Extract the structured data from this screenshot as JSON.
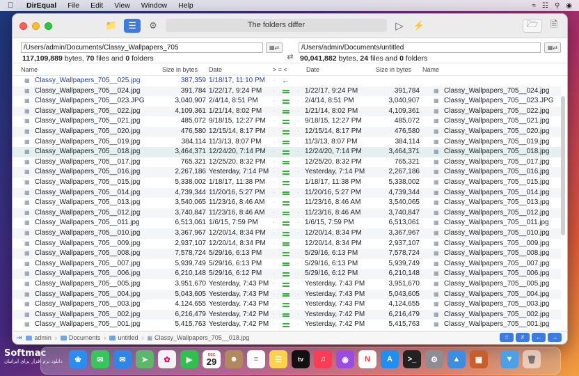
{
  "menubar": {
    "app_name": "DirEqual",
    "items": [
      "File",
      "Edit",
      "View",
      "Window",
      "Help"
    ]
  },
  "toolbar": {
    "status": "The folders differ"
  },
  "left": {
    "path": "/Users/admin/Documents/Classy_Wallpapers_705",
    "bytes": "117,109,889",
    "files": "70",
    "folders": "0"
  },
  "right": {
    "path": "/Users/admin/Documents/untitled",
    "bytes": "90,041,882",
    "files": "24",
    "folders": "0"
  },
  "summary_words": {
    "bytes": "bytes,",
    "files": "files and",
    "folders": "folders"
  },
  "columns": {
    "name": "Name",
    "size": "Size in bytes",
    "date": "Date",
    "compare": "> = <",
    "rdate": "Date",
    "rsize": "Size in bytes",
    "rname": "Name"
  },
  "rows": [
    {
      "lname": "Classy_Wallpapers_705__025.jpg",
      "lsize": "387,359",
      "ldate": "1/18/17, 11:10 PM",
      "cmp": "left",
      "rname": "",
      "rsize": "",
      "rdate": ""
    },
    {
      "lname": "Classy_Wallpapers_705__024.jpg",
      "lsize": "391,784",
      "ldate": "1/22/17, 9:24 PM",
      "cmp": "eq",
      "rname": "Classy_Wallpapers_705__024.jpg",
      "rsize": "391,784",
      "rdate": "1/22/17, 9:24 PM"
    },
    {
      "lname": "Classy_Wallpapers_705__023.JPG",
      "lsize": "3,040,907",
      "ldate": "2/4/14, 8:51 PM",
      "cmp": "eq",
      "rname": "Classy_Wallpapers_705__023.JPG",
      "rsize": "3,040,907",
      "rdate": "2/4/14, 8:51 PM"
    },
    {
      "lname": "Classy_Wallpapers_705__022.jpg",
      "lsize": "4,109,361",
      "ldate": "1/21/14, 8:02 PM",
      "cmp": "eq",
      "rname": "Classy_Wallpapers_705__022.jpg",
      "rsize": "4,109,361",
      "rdate": "1/21/14, 8:02 PM"
    },
    {
      "lname": "Classy_Wallpapers_705__021.jpg",
      "lsize": "485,072",
      "ldate": "9/18/15, 12:27 PM",
      "cmp": "eq",
      "rname": "Classy_Wallpapers_705__021.jpg",
      "rsize": "485,072",
      "rdate": "9/18/15, 12:27 PM"
    },
    {
      "lname": "Classy_Wallpapers_705__020.jpg",
      "lsize": "476,580",
      "ldate": "12/15/14, 8:17 PM",
      "cmp": "eq",
      "rname": "Classy_Wallpapers_705__020.jpg",
      "rsize": "476,580",
      "rdate": "12/15/14, 8:17 PM"
    },
    {
      "lname": "Classy_Wallpapers_705__019.jpg",
      "lsize": "384,114",
      "ldate": "11/3/13, 8:07 PM",
      "cmp": "eq",
      "rname": "Classy_Wallpapers_705__019.jpg",
      "rsize": "384,114",
      "rdate": "11/3/13, 8:07 PM"
    },
    {
      "lname": "Classy_Wallpapers_705__018.jpg",
      "lsize": "3,464,371",
      "ldate": "12/24/20, 7:14 PM",
      "cmp": "eq",
      "rname": "Classy_Wallpapers_705__018.jpg",
      "rsize": "3,464,371",
      "rdate": "12/24/20, 7:14 PM",
      "selected": true
    },
    {
      "lname": "Classy_Wallpapers_705__017.jpg",
      "lsize": "765,321",
      "ldate": "12/25/20, 8:32 PM",
      "cmp": "eq",
      "rname": "Classy_Wallpapers_705__017.jpg",
      "rsize": "765,321",
      "rdate": "12/25/20, 8:32 PM"
    },
    {
      "lname": "Classy_Wallpapers_705__016.jpg",
      "lsize": "2,267,186",
      "ldate": "Yesterday, 7:14 PM",
      "cmp": "eq",
      "rname": "Classy_Wallpapers_705__016.jpg",
      "rsize": "2,267,186",
      "rdate": "Yesterday, 7:14 PM"
    },
    {
      "lname": "Classy_Wallpapers_705__015.jpg",
      "lsize": "5,338,002",
      "ldate": "1/18/17, 11:38 PM",
      "cmp": "eq",
      "rname": "Classy_Wallpapers_705__015.jpg",
      "rsize": "5,338,002",
      "rdate": "1/18/17, 11:38 PM"
    },
    {
      "lname": "Classy_Wallpapers_705__014.jpg",
      "lsize": "4,739,344",
      "ldate": "11/20/16, 5:27 PM",
      "cmp": "eq",
      "rname": "Classy_Wallpapers_705__014.jpg",
      "rsize": "4,739,344",
      "rdate": "11/20/16, 5:27 PM"
    },
    {
      "lname": "Classy_Wallpapers_705__013.jpg",
      "lsize": "3,540,065",
      "ldate": "11/23/16, 8:46 AM",
      "cmp": "eq",
      "rname": "Classy_Wallpapers_705__013.jpg",
      "rsize": "3,540,065",
      "rdate": "11/23/16, 8:46 AM"
    },
    {
      "lname": "Classy_Wallpapers_705__012.jpg",
      "lsize": "3,740,847",
      "ldate": "11/23/16, 8:46 AM",
      "cmp": "eq",
      "rname": "Classy_Wallpapers_705__012.jpg",
      "rsize": "3,740,847",
      "rdate": "11/23/16, 8:46 AM"
    },
    {
      "lname": "Classy_Wallpapers_705__011.jpg",
      "lsize": "6,513,061",
      "ldate": "1/6/15, 7:59 PM",
      "cmp": "eq",
      "rname": "Classy_Wallpapers_705__011.jpg",
      "rsize": "6,513,061",
      "rdate": "1/6/15, 7:59 PM"
    },
    {
      "lname": "Classy_Wallpapers_705__010.jpg",
      "lsize": "3,367,967",
      "ldate": "12/20/14, 8:34 PM",
      "cmp": "eq",
      "rname": "Classy_Wallpapers_705__010.jpg",
      "rsize": "3,367,967",
      "rdate": "12/20/14, 8:34 PM"
    },
    {
      "lname": "Classy_Wallpapers_705__009.jpg",
      "lsize": "2,937,107",
      "ldate": "12/20/14, 8:34 PM",
      "cmp": "eq",
      "rname": "Classy_Wallpapers_705__009.jpg",
      "rsize": "2,937,107",
      "rdate": "12/20/14, 8:34 PM"
    },
    {
      "lname": "Classy_Wallpapers_705__008.jpg",
      "lsize": "7,578,724",
      "ldate": "5/29/16, 6:13 PM",
      "cmp": "eq",
      "rname": "Classy_Wallpapers_705__008.jpg",
      "rsize": "7,578,724",
      "rdate": "5/29/16, 6:13 PM"
    },
    {
      "lname": "Classy_Wallpapers_705__007.jpg",
      "lsize": "5,939,749",
      "ldate": "5/29/16, 6:13 PM",
      "cmp": "eq",
      "rname": "Classy_Wallpapers_705__007.jpg",
      "rsize": "5,939,749",
      "rdate": "5/29/16, 6:13 PM"
    },
    {
      "lname": "Classy_Wallpapers_705__006.jpg",
      "lsize": "6,210,148",
      "ldate": "5/29/16, 6:12 PM",
      "cmp": "eq",
      "rname": "Classy_Wallpapers_705__006.jpg",
      "rsize": "6,210,148",
      "rdate": "5/29/16, 6:12 PM"
    },
    {
      "lname": "Classy_Wallpapers_705__005.jpg",
      "lsize": "3,951,670",
      "ldate": "Yesterday, 7:43 PM",
      "cmp": "eq",
      "rname": "Classy_Wallpapers_705__005.jpg",
      "rsize": "3,951,670",
      "rdate": "Yesterday, 7:43 PM"
    },
    {
      "lname": "Classy_Wallpapers_705__004.jpg",
      "lsize": "5,043,605",
      "ldate": "Yesterday, 7:43 PM",
      "cmp": "eq",
      "rname": "Classy_Wallpapers_705__004.jpg",
      "rsize": "5,043,605",
      "rdate": "Yesterday, 7:43 PM"
    },
    {
      "lname": "Classy_Wallpapers_705__003.jpg",
      "lsize": "4,124,655",
      "ldate": "Yesterday, 7:43 PM",
      "cmp": "eq",
      "rname": "Classy_Wallpapers_705__003.jpg",
      "rsize": "4,124,655",
      "rdate": "Yesterday, 7:43 PM"
    },
    {
      "lname": "Classy_Wallpapers_705__002.jpg",
      "lsize": "6,216,479",
      "ldate": "Yesterday, 7:42 PM",
      "cmp": "eq",
      "rname": "Classy_Wallpapers_705__002.jpg",
      "rsize": "6,216,479",
      "rdate": "Yesterday, 7:42 PM"
    },
    {
      "lname": "Classy_Wallpapers_705__001.jpg",
      "lsize": "5,415,763",
      "ldate": "Yesterday, 7:42 PM",
      "cmp": "eq",
      "rname": "Classy_Wallpapers_705__001.jpg",
      "rsize": "5,415,763",
      "rdate": "Yesterday, 7:42 PM"
    }
  ],
  "breadcrumb": [
    "admin",
    "Documents",
    "untitled",
    "Classy_Wallpapers_705__018.jpg"
  ],
  "dock": {
    "calendar_month": "DEC",
    "calendar_day": "29",
    "tv_label": "tv"
  },
  "watermark": {
    "brand": "Softmac",
    "subtitle": "دانلود نرم افزار برای ایرانیان"
  },
  "colors": {
    "accent": "#3d7be0",
    "equal": "#31b334",
    "diff_text": "#1a3fbf",
    "selected_row": "#e3f0ef"
  }
}
